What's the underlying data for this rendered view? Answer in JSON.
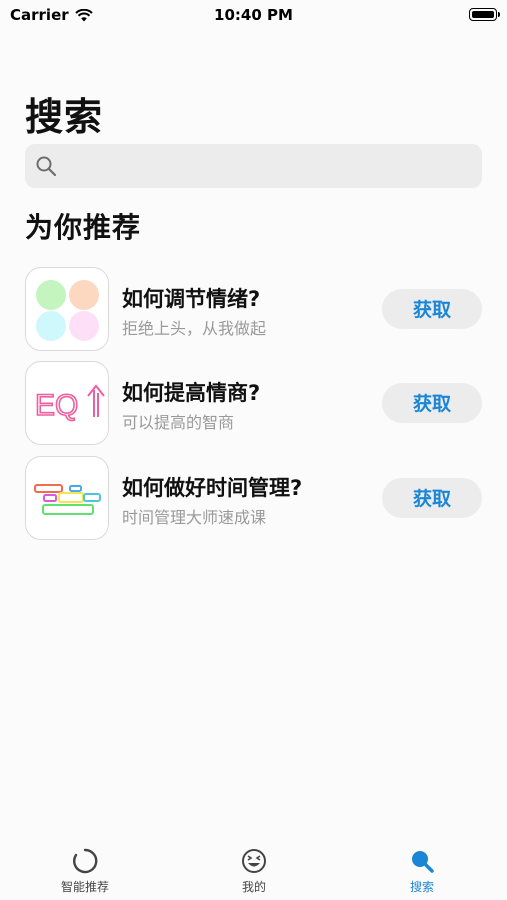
{
  "status_bar": {
    "carrier": "Carrier",
    "time": "10:40 PM"
  },
  "page": {
    "title": "搜索"
  },
  "search": {
    "placeholder": ""
  },
  "section": {
    "title": "为你推荐"
  },
  "apps": [
    {
      "name": "如何调节情绪?",
      "subtitle": "拒绝上头，从我做起",
      "button": "获取",
      "icon": "color-circles-icon"
    },
    {
      "name": "如何提高情商?",
      "subtitle": "可以提高的智商",
      "button": "获取",
      "icon": "eq-icon"
    },
    {
      "name": "如何做好时间管理?",
      "subtitle": "时间管理大师速成课",
      "button": "获取",
      "icon": "time-blocks-icon"
    }
  ],
  "tabs": [
    {
      "label": "智能推荐",
      "icon": "loading-ring-icon",
      "active": false
    },
    {
      "label": "我的",
      "icon": "laughing-face-icon",
      "active": false
    },
    {
      "label": "搜索",
      "icon": "search-icon",
      "active": true
    }
  ],
  "colors": {
    "accent": "#1b86d6",
    "background": "#fbfbfb",
    "search_bg": "#ececec"
  },
  "icon_art": {
    "eq_text": "EQ"
  }
}
